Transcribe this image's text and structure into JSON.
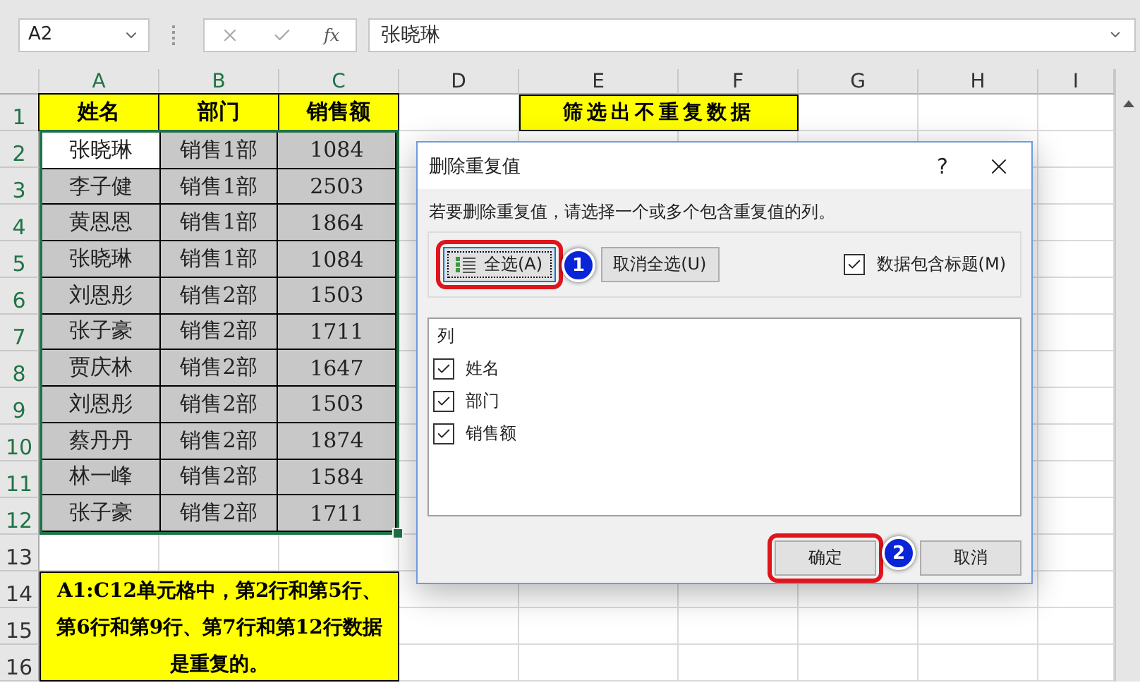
{
  "name_box": {
    "value": "A2"
  },
  "formula_bar": {
    "function_label": "fx",
    "value": "张晓琳"
  },
  "column_headers": [
    "A",
    "B",
    "C",
    "D",
    "E",
    "F",
    "G",
    "H",
    "I"
  ],
  "row_headers": [
    "1",
    "2",
    "3",
    "4",
    "5",
    "6",
    "7",
    "8",
    "9",
    "10",
    "11",
    "12",
    "13",
    "14",
    "15",
    "16"
  ],
  "table": {
    "columns": [
      "姓名",
      "部门",
      "销售额"
    ],
    "rows": [
      {
        "cells": [
          "张晓琳",
          "销售1部",
          "1084"
        ],
        "active": true
      },
      {
        "cells": [
          "李子健",
          "销售1部",
          "2503"
        ],
        "active": false
      },
      {
        "cells": [
          "黄恩恩",
          "销售1部",
          "1864"
        ],
        "active": false
      },
      {
        "cells": [
          "张晓琳",
          "销售1部",
          "1084"
        ],
        "active": false
      },
      {
        "cells": [
          "刘恩彤",
          "销售2部",
          "1503"
        ],
        "active": false
      },
      {
        "cells": [
          "张子豪",
          "销售2部",
          "1711"
        ],
        "active": false
      },
      {
        "cells": [
          "贾庆林",
          "销售2部",
          "1647"
        ],
        "active": false
      },
      {
        "cells": [
          "刘恩彤",
          "销售2部",
          "1503"
        ],
        "active": false
      },
      {
        "cells": [
          "蔡丹丹",
          "销售2部",
          "1874"
        ],
        "active": false
      },
      {
        "cells": [
          "林一峰",
          "销售2部",
          "1584"
        ],
        "active": false
      },
      {
        "cells": [
          "张子豪",
          "销售2部",
          "1711"
        ],
        "active": false
      }
    ]
  },
  "title_cell": "筛选出不重复数据",
  "note": "A1:C12单元格中，第2行和第5行、第6行和第9行、第7行和第12行数据是重复的。",
  "dialog": {
    "title": "删除重复值",
    "help": "?",
    "instruction": "若要删除重复值，请选择一个或多个包含重复值的列。",
    "select_all": {
      "label": "全选(A)",
      "highlighted": true,
      "callout": "1"
    },
    "unselect_all": {
      "label": "取消全选(U)"
    },
    "header_checkbox": {
      "label": "数据包含标题(M)",
      "checked": true
    },
    "list_header": "列",
    "columns": [
      {
        "label": "姓名",
        "checked": true
      },
      {
        "label": "部门",
        "checked": true
      },
      {
        "label": "销售额",
        "checked": true
      }
    ],
    "ok": {
      "label": "确定",
      "highlighted": true,
      "callout": "2"
    },
    "cancel": {
      "label": "取消"
    }
  }
}
